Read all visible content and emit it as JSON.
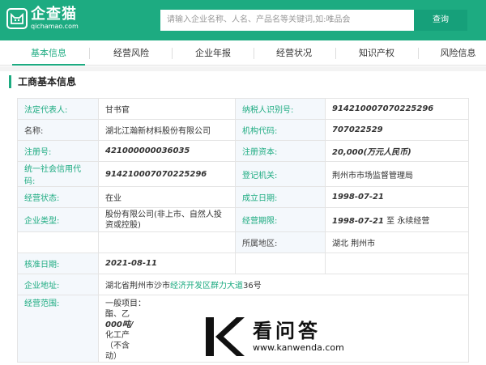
{
  "header": {
    "logo_name": "企查猫",
    "logo_domain": "qichamao.com",
    "search_placeholder": "请输入企业名称、人名、产品名等关键词,如:唯品会",
    "search_button": "查询"
  },
  "tabs": [
    {
      "label": "基本信息",
      "active": true
    },
    {
      "label": "经营风险",
      "active": false
    },
    {
      "label": "企业年报",
      "active": false
    },
    {
      "label": "经营状况",
      "active": false
    },
    {
      "label": "知识产权",
      "active": false
    },
    {
      "label": "风险信息",
      "active": false
    }
  ],
  "section_title": "工商基本信息",
  "rows": {
    "legal_rep": {
      "label": "法定代表人:",
      "value": "甘书官"
    },
    "tax_id": {
      "label": "纳税人识别号:",
      "value": "914210007070225296"
    },
    "name": {
      "label": "名称:",
      "value": "湖北江瀚新材料股份有限公司"
    },
    "org_code": {
      "label": "机构代码:",
      "value": "707022529"
    },
    "reg_no": {
      "label": "注册号:",
      "value": "421000000036035"
    },
    "reg_capital": {
      "label": "注册资本:",
      "value": "20,000(万元人民币)"
    },
    "credit_code": {
      "label": "统一社会信用代码:",
      "value": "914210007070225296"
    },
    "reg_authority": {
      "label": "登记机关:",
      "value": "荆州市市场监督管理局"
    },
    "status": {
      "label": "经营状态:",
      "value": "在业"
    },
    "founded": {
      "label": "成立日期:",
      "value": "1998-07-21"
    },
    "company_type": {
      "label": "企业类型:",
      "value": "股份有限公司(非上市、自然人投资或控股)"
    },
    "term": {
      "label": "经营期限:",
      "value": "1998-07-21",
      "suffix": " 至 永续经营"
    },
    "region": {
      "label": "所属地区:",
      "value": "湖北 荆州市"
    },
    "approved": {
      "label": "核准日期:",
      "value": "2021-08-11"
    },
    "address": {
      "label": "企业地址:",
      "prefix": "湖北省荆州市沙市",
      "link": "经济开发区群力大道",
      "suffix": "36号"
    },
    "scope": {
      "label": "经营范围:",
      "lines": [
        "一般项目：",
        "酯、乙",
        "000吨/",
        "化工产",
        "（不含",
        "动）"
      ]
    }
  },
  "watermark": {
    "big": "看问答",
    "small": "www.kanwenda.com"
  },
  "colors": {
    "brand": "#1dab81",
    "label_bg": "#f4f8fc"
  }
}
